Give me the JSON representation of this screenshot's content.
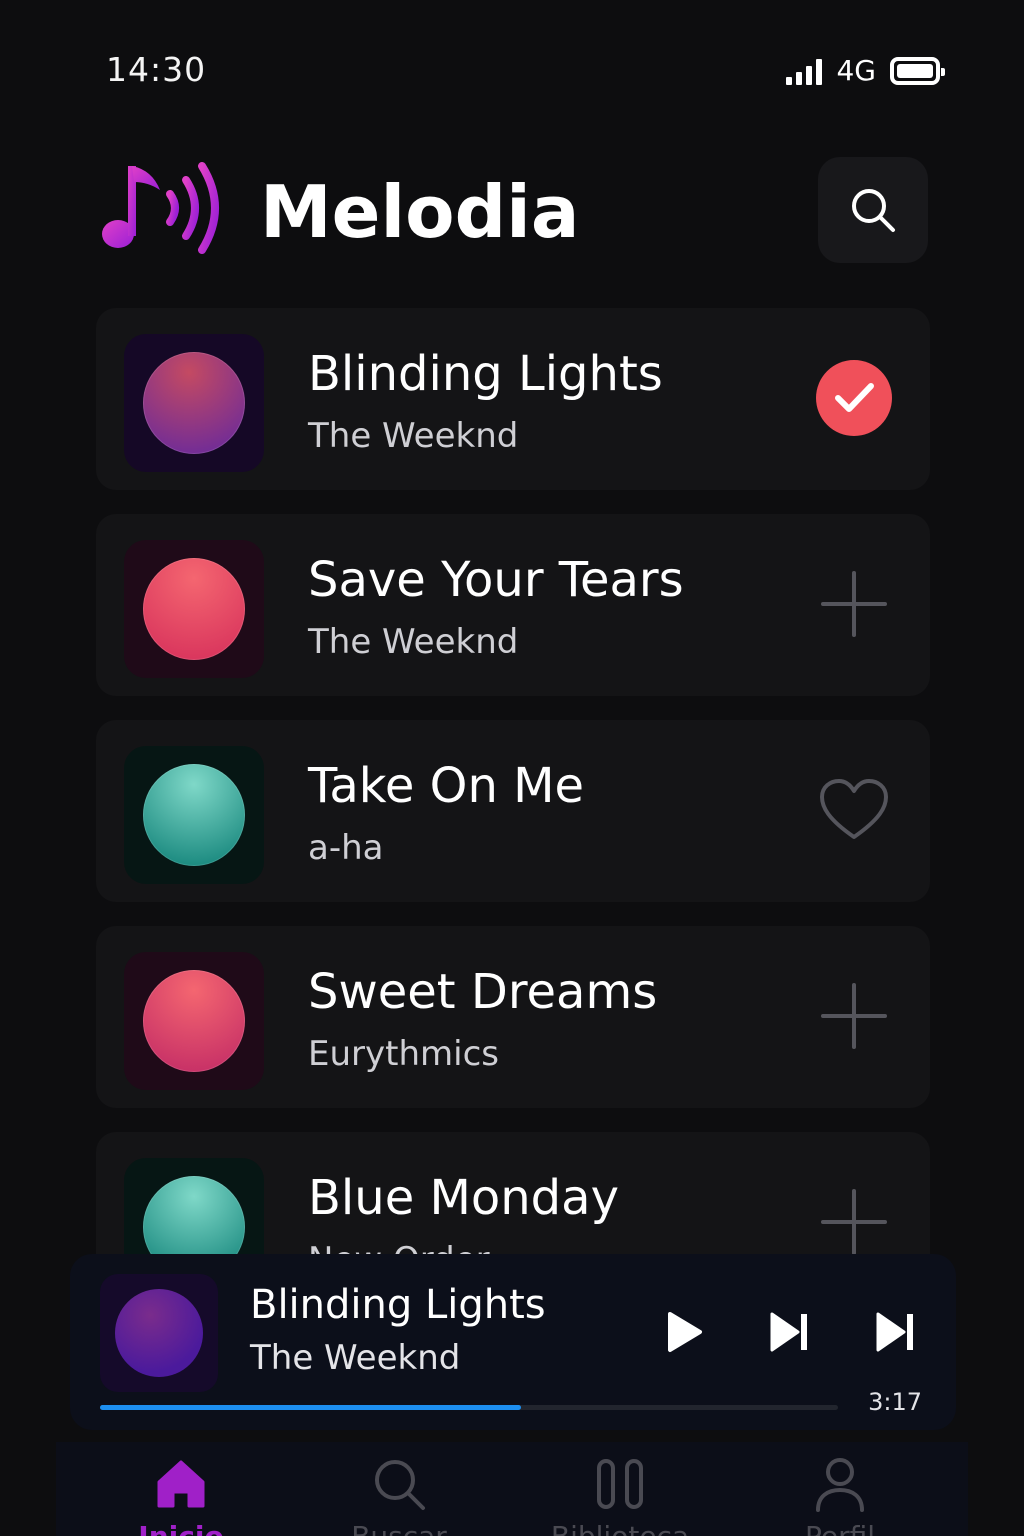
{
  "status_bar": {
    "time": "14:30",
    "network": "4G"
  },
  "header": {
    "title": "Melodia"
  },
  "songs": [
    {
      "title": "Blinding Lights",
      "artist": "The Weeknd",
      "action": "check-icon",
      "art_color": "#b8396a"
    },
    {
      "title": "Save Your Tears",
      "artist": "The Weeknd",
      "action": "plus-icon",
      "art_color": "#f05a6a"
    },
    {
      "title": "Take On Me",
      "artist": "a-ha",
      "action": "heart-icon",
      "art_color": "#3cbaa8"
    },
    {
      "title": "Sweet Dreams",
      "artist": "Eurythmics",
      "action": "plus-icon",
      "art_color": "#f05a6a"
    },
    {
      "title": "Blue Monday",
      "artist": "New Order",
      "action": "plus-icon",
      "art_color": "#3cbaa8"
    }
  ],
  "player": {
    "title": "Blinding Lights",
    "artist": "The Weeknd",
    "elapsed": "3:17",
    "progress": 0.57,
    "accent": "#1d8ff0"
  },
  "nav": {
    "items": [
      {
        "label": "Inicio",
        "icon": "home-icon",
        "active": true
      },
      {
        "label": "Buscar",
        "icon": "search-icon",
        "active": false
      },
      {
        "label": "Biblioteca",
        "icon": "library-icon",
        "active": false
      },
      {
        "label": "Perfil",
        "icon": "profile-icon",
        "active": false
      }
    ]
  },
  "colors": {
    "brand": "#c026d3",
    "active_nav": "#a020c8",
    "check": "#f0505a"
  }
}
